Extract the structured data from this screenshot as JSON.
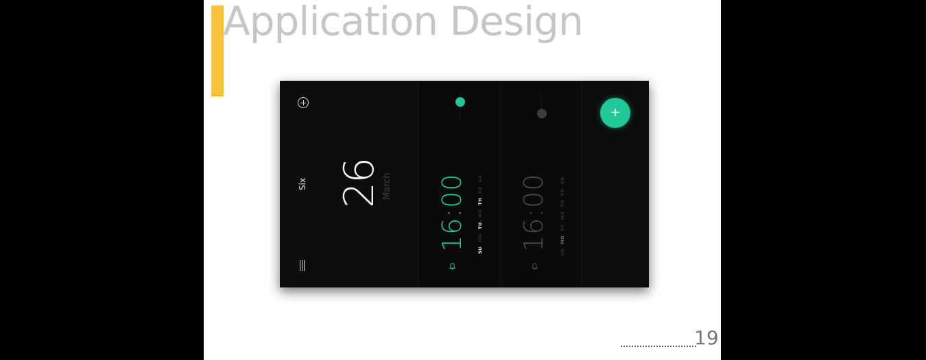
{
  "slide": {
    "title": "Application Design",
    "page_number": "19"
  },
  "colors": {
    "accent_bar": "#f8c33a",
    "app_background": "#0c0c0c",
    "active_green": "#1fc896",
    "inactive_gray": "#4a4a4a"
  },
  "app": {
    "date_panel": {
      "day_name": "Six",
      "date_number": "26",
      "month": "March",
      "add_icon": "add-circle-icon",
      "menu_icon": "menu-icon"
    },
    "alarms": [
      {
        "time": "16:00",
        "enabled": true,
        "days": [
          "SU",
          "MO",
          "TU",
          "WE",
          "TH",
          "FR",
          "SA"
        ],
        "active_days": [
          "SU",
          "TU",
          "TH"
        ],
        "icon": "bell-icon"
      },
      {
        "time": "16:00",
        "enabled": false,
        "days": [
          "SU",
          "MO",
          "TU",
          "WE",
          "TH",
          "FR",
          "SA"
        ],
        "active_days": [
          "MO"
        ],
        "icon": "bell-icon"
      }
    ],
    "fab": {
      "label": "+"
    }
  }
}
